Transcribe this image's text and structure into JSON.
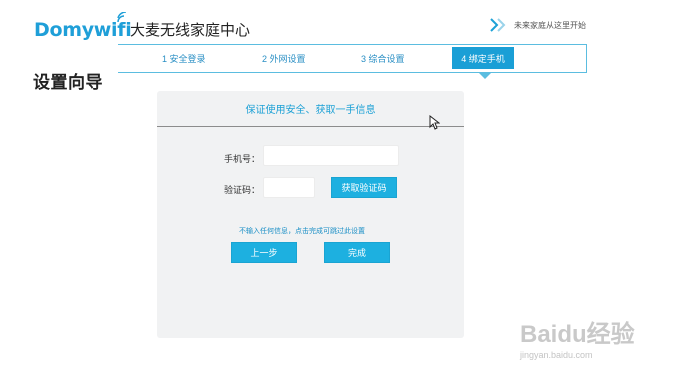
{
  "header": {
    "logo_text": "Domywifi",
    "brand_name": "大麦无线家庭中心",
    "tagline": "未来家庭从这里开始"
  },
  "steps": [
    {
      "label": "1 安全登录"
    },
    {
      "label": "2 外网设置"
    },
    {
      "label": "3 综合设置"
    },
    {
      "label": "4 绑定手机",
      "active": true
    }
  ],
  "page_title": "设置向导",
  "form": {
    "heading": "保证使用安全、获取一手信息",
    "phone_label": "手机号：",
    "phone_value": "",
    "code_label": "验证码：",
    "code_value": "",
    "get_code_button": "获取验证码",
    "hint": "不输入任何信息，点击完成可跳过此设置",
    "prev_button": "上一步",
    "finish_button": "完成"
  },
  "watermark": {
    "logo": "Baidu经验",
    "url": "jingyan.baidu.com"
  },
  "colors": {
    "accent": "#1da1d6",
    "button": "#1db0e0",
    "panel_bg": "#f1f2f3"
  }
}
